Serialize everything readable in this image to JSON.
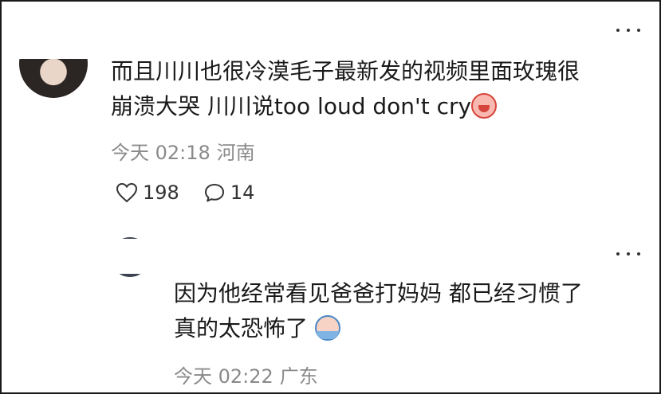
{
  "comment": {
    "text_line1": "而且川川也很冷漠毛子最新发的视频里面玫瑰很",
    "text_line2": "崩溃大哭 川川说too loud don't cry",
    "emoji": "crying-face-icon",
    "time": "今天 02:18",
    "location": "河南",
    "likes": "198",
    "replies": "14"
  },
  "reply": {
    "text_line1": "因为他经常看见爸爸打妈妈 都已经习惯了",
    "text_line2": "真的太恐怖了 ",
    "emoji": "scared-face-icon",
    "time": "今天 02:22",
    "location": "广东"
  },
  "colors": {
    "text": "#1a1a1a",
    "meta": "#8a8a8a",
    "border": "#1a1a1a"
  }
}
